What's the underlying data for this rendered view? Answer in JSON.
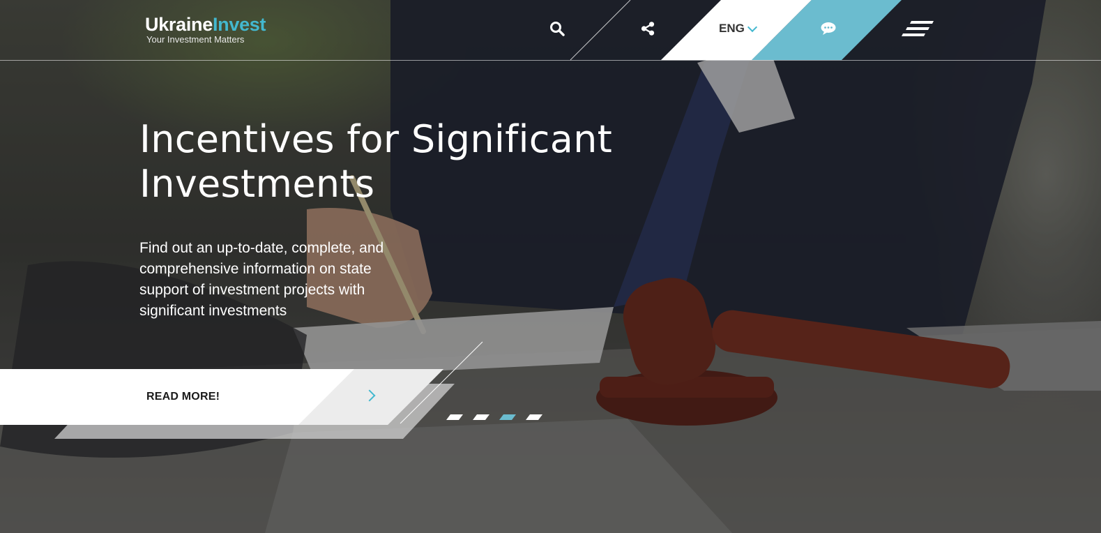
{
  "header": {
    "logo_primary": "Ukraine",
    "logo_accent": "Invest",
    "logo_tagline": "Your Investment Matters",
    "language": "ENG",
    "icons": [
      "search-icon",
      "share-icon",
      "chat-icon",
      "menu-icon"
    ]
  },
  "hero": {
    "title_line1": "Incentives for Significant",
    "title_line2": "Investments",
    "description": "Find out an up-to-date, complete, and comprehensive information on state support of investment projects with significant investments",
    "button_label": "READ MORE!",
    "slides": 4,
    "active_slide": 3
  },
  "colors": {
    "accent": "#43b8cf",
    "panel_white": "#ffffff",
    "panel_light": "#ececec"
  }
}
